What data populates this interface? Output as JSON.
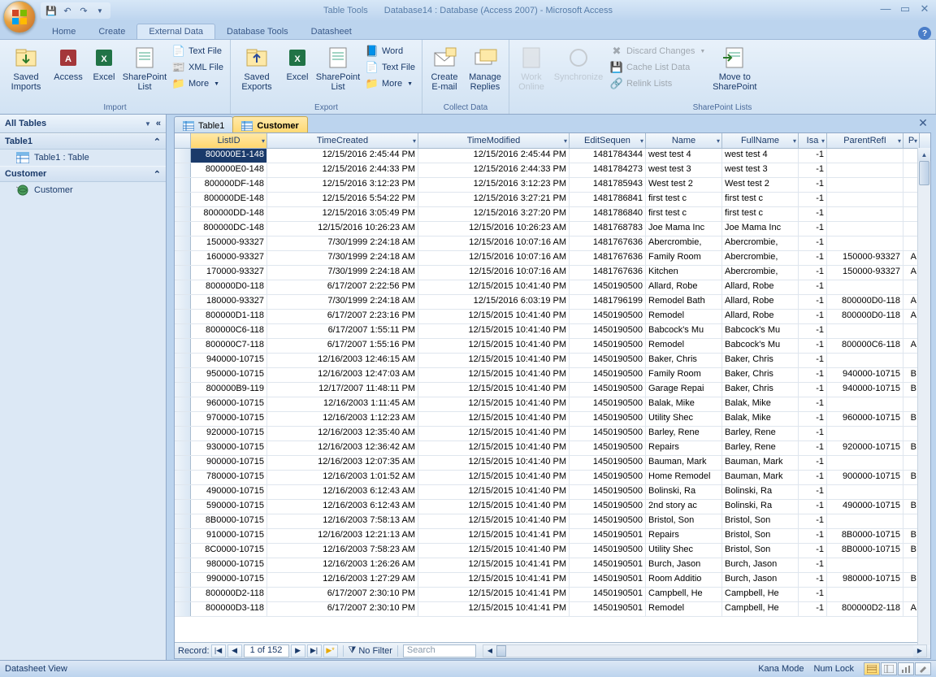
{
  "title": {
    "context": "Table Tools",
    "main": "Database14 : Database (Access 2007) - Microsoft Access"
  },
  "tabs": [
    "Home",
    "Create",
    "External Data",
    "Database Tools",
    "Datasheet"
  ],
  "activeTab": 2,
  "ribbon": {
    "import": {
      "label": "Import",
      "saved": "Saved\nImports",
      "access": "Access",
      "excel": "Excel",
      "sp": "SharePoint\nList",
      "txt": "Text File",
      "xml": "XML File",
      "more": "More"
    },
    "export": {
      "label": "Export",
      "saved": "Saved\nExports",
      "excel": "Excel",
      "sp": "SharePoint\nList",
      "word": "Word",
      "txt": "Text File",
      "more": "More"
    },
    "collect": {
      "label": "Collect Data",
      "create": "Create\nE-mail",
      "manage": "Manage\nReplies"
    },
    "splists": {
      "label": "SharePoint Lists",
      "work": "Work\nOnline",
      "sync": "Synchronize",
      "discard": "Discard Changes",
      "cache": "Cache List Data",
      "relink": "Relink Lists",
      "move": "Move to\nSharePoint"
    }
  },
  "nav": {
    "header": "All Tables",
    "g1": "Table1",
    "i1": "Table1 : Table",
    "g2": "Customer",
    "i2": "Customer"
  },
  "docTabs": [
    {
      "label": "Table1",
      "active": false
    },
    {
      "label": "Customer",
      "active": true
    }
  ],
  "cols": [
    "ListID",
    "TimeCreated",
    "TimeModified",
    "EditSequen",
    "Name",
    "FullName",
    "Isa",
    "ParentRefI",
    "P"
  ],
  "rows": [
    [
      "800000E1-148",
      "12/15/2016 2:45:44 PM",
      "12/15/2016 2:45:44 PM",
      "1481784344",
      "west test 4",
      "west test 4",
      "-1",
      "",
      ""
    ],
    [
      "800000E0-148",
      "12/15/2016 2:44:33 PM",
      "12/15/2016 2:44:33 PM",
      "1481784273",
      "west test 3",
      "west test 3",
      "-1",
      "",
      ""
    ],
    [
      "800000DF-148",
      "12/15/2016 3:12:23 PM",
      "12/15/2016 3:12:23 PM",
      "1481785943",
      "West test 2",
      "West test 2",
      "-1",
      "",
      ""
    ],
    [
      "800000DE-148",
      "12/15/2016 5:54:22 PM",
      "12/15/2016 3:27:21 PM",
      "1481786841",
      "first test c",
      "first test c",
      "-1",
      "",
      ""
    ],
    [
      "800000DD-148",
      "12/15/2016 3:05:49 PM",
      "12/15/2016 3:27:20 PM",
      "1481786840",
      "first test c",
      "first test c",
      "-1",
      "",
      ""
    ],
    [
      "800000DC-148",
      "12/15/2016 10:26:23 AM",
      "12/15/2016 10:26:23 AM",
      "1481768783",
      "Joe Mama Inc",
      "Joe Mama Inc",
      "-1",
      "",
      ""
    ],
    [
      "150000-93327",
      "7/30/1999 2:24:18 AM",
      "12/15/2016 10:07:16 AM",
      "1481767636",
      "Abercrombie,",
      "Abercrombie,",
      "-1",
      "",
      ""
    ],
    [
      "160000-93327",
      "7/30/1999 2:24:18 AM",
      "12/15/2016 10:07:16 AM",
      "1481767636",
      "Family Room",
      "Abercrombie,",
      "-1",
      "150000-93327",
      "A"
    ],
    [
      "170000-93327",
      "7/30/1999 2:24:18 AM",
      "12/15/2016 10:07:16 AM",
      "1481767636",
      "Kitchen",
      "Abercrombie,",
      "-1",
      "150000-93327",
      "A"
    ],
    [
      "800000D0-118",
      "6/17/2007 2:22:56 PM",
      "12/15/2015 10:41:40 PM",
      "1450190500",
      "Allard, Robe",
      "Allard, Robe",
      "-1",
      "",
      ""
    ],
    [
      "180000-93327",
      "7/30/1999 2:24:18 AM",
      "12/15/2016 6:03:19 PM",
      "1481796199",
      "Remodel Bath",
      "Allard, Robe",
      "-1",
      "800000D0-118",
      "A"
    ],
    [
      "800000D1-118",
      "6/17/2007 2:23:16 PM",
      "12/15/2015 10:41:40 PM",
      "1450190500",
      "Remodel",
      "Allard, Robe",
      "-1",
      "800000D0-118",
      "A"
    ],
    [
      "800000C6-118",
      "6/17/2007 1:55:11 PM",
      "12/15/2015 10:41:40 PM",
      "1450190500",
      "Babcock's Mu",
      "Babcock's Mu",
      "-1",
      "",
      ""
    ],
    [
      "800000C7-118",
      "6/17/2007 1:55:16 PM",
      "12/15/2015 10:41:40 PM",
      "1450190500",
      "Remodel",
      "Babcock's Mu",
      "-1",
      "800000C6-118",
      "A"
    ],
    [
      "940000-10715",
      "12/16/2003 12:46:15 AM",
      "12/15/2015 10:41:40 PM",
      "1450190500",
      "Baker, Chris",
      "Baker, Chris",
      "-1",
      "",
      ""
    ],
    [
      "950000-10715",
      "12/16/2003 12:47:03 AM",
      "12/15/2015 10:41:40 PM",
      "1450190500",
      "Family Room",
      "Baker, Chris",
      "-1",
      "940000-10715",
      "B"
    ],
    [
      "800000B9-119",
      "12/17/2007 11:48:11 PM",
      "12/15/2015 10:41:40 PM",
      "1450190500",
      "Garage Repai",
      "Baker, Chris",
      "-1",
      "940000-10715",
      "B"
    ],
    [
      "960000-10715",
      "12/16/2003 1:11:45 AM",
      "12/15/2015 10:41:40 PM",
      "1450190500",
      "Balak, Mike",
      "Balak, Mike",
      "-1",
      "",
      ""
    ],
    [
      "970000-10715",
      "12/16/2003 1:12:23 AM",
      "12/15/2015 10:41:40 PM",
      "1450190500",
      "Utility Shec",
      "Balak, Mike",
      "-1",
      "960000-10715",
      "B"
    ],
    [
      "920000-10715",
      "12/16/2003 12:35:40 AM",
      "12/15/2015 10:41:40 PM",
      "1450190500",
      "Barley, Rene",
      "Barley, Rene",
      "-1",
      "",
      ""
    ],
    [
      "930000-10715",
      "12/16/2003 12:36:42 AM",
      "12/15/2015 10:41:40 PM",
      "1450190500",
      "Repairs",
      "Barley, Rene",
      "-1",
      "920000-10715",
      "B"
    ],
    [
      "900000-10715",
      "12/16/2003 12:07:35 AM",
      "12/15/2015 10:41:40 PM",
      "1450190500",
      "Bauman, Mark",
      "Bauman, Mark",
      "-1",
      "",
      ""
    ],
    [
      "780000-10715",
      "12/16/2003 1:01:52 AM",
      "12/15/2015 10:41:40 PM",
      "1450190500",
      "Home Remodel",
      "Bauman, Mark",
      "-1",
      "900000-10715",
      "B"
    ],
    [
      "490000-10715",
      "12/16/2003 6:12:43 AM",
      "12/15/2015 10:41:40 PM",
      "1450190500",
      "Bolinski, Ra",
      "Bolinski, Ra",
      "-1",
      "",
      ""
    ],
    [
      "590000-10715",
      "12/16/2003 6:12:43 AM",
      "12/15/2015 10:41:40 PM",
      "1450190500",
      "2nd story ac",
      "Bolinski, Ra",
      "-1",
      "490000-10715",
      "B"
    ],
    [
      "8B0000-10715",
      "12/16/2003 7:58:13 AM",
      "12/15/2015 10:41:40 PM",
      "1450190500",
      "Bristol, Son",
      "Bristol, Son",
      "-1",
      "",
      ""
    ],
    [
      "910000-10715",
      "12/16/2003 12:21:13 AM",
      "12/15/2015 10:41:41 PM",
      "1450190501",
      "Repairs",
      "Bristol, Son",
      "-1",
      "8B0000-10715",
      "B"
    ],
    [
      "8C0000-10715",
      "12/16/2003 7:58:23 AM",
      "12/15/2015 10:41:40 PM",
      "1450190500",
      "Utility Shec",
      "Bristol, Son",
      "-1",
      "8B0000-10715",
      "B"
    ],
    [
      "980000-10715",
      "12/16/2003 1:26:26 AM",
      "12/15/2015 10:41:41 PM",
      "1450190501",
      "Burch, Jason",
      "Burch, Jason",
      "-1",
      "",
      ""
    ],
    [
      "990000-10715",
      "12/16/2003 1:27:29 AM",
      "12/15/2015 10:41:41 PM",
      "1450190501",
      "Room Additio",
      "Burch, Jason",
      "-1",
      "980000-10715",
      "B"
    ],
    [
      "800000D2-118",
      "6/17/2007 2:30:10 PM",
      "12/15/2015 10:41:41 PM",
      "1450190501",
      "Campbell, He",
      "Campbell, He",
      "-1",
      "",
      ""
    ],
    [
      "800000D3-118",
      "6/17/2007 2:30:10 PM",
      "12/15/2015 10:41:41 PM",
      "1450190501",
      "Remodel",
      "Campbell, He",
      "-1",
      "800000D2-118",
      "A"
    ]
  ],
  "recNav": {
    "label": "Record:",
    "pos": "1 of 152",
    "filter": "No Filter",
    "search": "Search"
  },
  "status": {
    "left": "Datasheet View",
    "kana": "Kana Mode",
    "num": "Num Lock"
  }
}
